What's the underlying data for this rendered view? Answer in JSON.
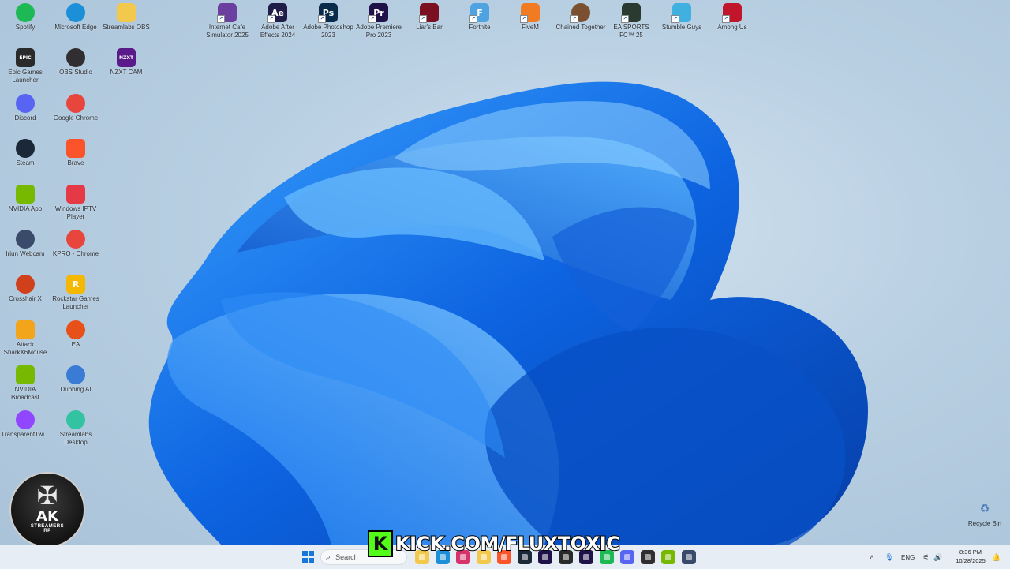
{
  "desktop": {
    "icons": [
      {
        "label": "Spotify",
        "icon": "spotify-icon",
        "color": "#1db954"
      },
      {
        "label": "Microsoft Edge",
        "icon": "edge-icon",
        "color": "#1b8fd8"
      },
      {
        "label": "Streamlabs OBS",
        "icon": "folder-icon",
        "color": "#f2c94c"
      },
      {
        "label": "Internet Cafe Simulator 2025",
        "icon": "game-icon",
        "color": "#6b3fa0"
      },
      {
        "label": "Adobe After Effects 2024",
        "icon": "after-effects-icon",
        "color": "#1f1d48",
        "text": "Ae"
      },
      {
        "label": "Adobe Photoshop 2023",
        "icon": "photoshop-icon",
        "color": "#0a2a4a",
        "text": "Ps"
      },
      {
        "label": "Adobe Premiere Pro 2023",
        "icon": "premiere-icon",
        "color": "#1e1248",
        "text": "Pr"
      },
      {
        "label": "Liar's Bar",
        "icon": "liars-bar-icon",
        "color": "#7a1020"
      },
      {
        "label": "Fortnite",
        "icon": "fortnite-icon",
        "color": "#4fa3e0",
        "text": "F"
      },
      {
        "label": "FiveM",
        "icon": "fivem-icon",
        "color": "#f07b22"
      },
      {
        "label": "Chained Together",
        "icon": "chained-together-icon",
        "color": "#7a5030"
      },
      {
        "label": "EA SPORTS FC™ 25",
        "icon": "ea-fc-icon",
        "color": "#2a3a30"
      },
      {
        "label": "Stumble Guys",
        "icon": "stumble-guys-icon",
        "color": "#3fb0e0"
      },
      {
        "label": "Among Us",
        "icon": "among-us-icon",
        "color": "#c0152a"
      },
      {
        "label": "Epic Games Launcher",
        "icon": "epic-games-icon",
        "color": "#2a2a2a",
        "text": "EPIC"
      },
      {
        "label": "OBS Studio",
        "icon": "obs-icon",
        "color": "#302e31"
      },
      {
        "label": "NZXT CAM",
        "icon": "nzxt-icon",
        "color": "#5a1a8a",
        "text": "NZXT"
      },
      {
        "label": "Discord",
        "icon": "discord-icon",
        "color": "#5865f2"
      },
      {
        "label": "Google Chrome",
        "icon": "chrome-icon",
        "color": "#e8453c"
      },
      {
        "label": "Steam",
        "icon": "steam-icon",
        "color": "#1b2838"
      },
      {
        "label": "Brave",
        "icon": "brave-icon",
        "color": "#fb542b"
      },
      {
        "label": "NVIDIA App",
        "icon": "nvidia-icon",
        "color": "#76b900"
      },
      {
        "label": "Windows IPTV Player",
        "icon": "iptv-player-icon",
        "color": "#e63946"
      },
      {
        "label": "Iriun Webcam",
        "icon": "webcam-icon",
        "color": "#3a4a6a"
      },
      {
        "label": "KPRO - Chrome",
        "icon": "chrome-icon",
        "color": "#e8453c"
      },
      {
        "label": "Crosshair X",
        "icon": "crosshair-icon",
        "color": "#d0401a"
      },
      {
        "label": "Rockstar Games Launcher",
        "icon": "rockstar-icon",
        "color": "#f5b800",
        "text": "R"
      },
      {
        "label": "Attack SharkX6Mouse",
        "icon": "mouse-icon",
        "color": "#f2a51a"
      },
      {
        "label": "EA",
        "icon": "ea-icon",
        "color": "#e8501a"
      },
      {
        "label": "NVIDIA Broadcast",
        "icon": "nvidia-broadcast-icon",
        "color": "#76b900"
      },
      {
        "label": "Dubbing AI",
        "icon": "dubbing-ai-icon",
        "color": "#3a7bd5"
      },
      {
        "label": "TransparentTwi...",
        "icon": "transparent-twitch-icon",
        "color": "#9146ff"
      },
      {
        "label": "Streamlabs Desktop",
        "icon": "streamlabs-icon",
        "color": "#31c3a2"
      }
    ],
    "recycle_bin": {
      "label": "Recycle Bin",
      "icon": "recycle-bin-icon"
    },
    "overlay_logo": {
      "big": "AK",
      "sub": "STREAMERS",
      "sub2": "RP"
    },
    "kick_banner": {
      "k": "K",
      "url": "KICK.COM/FLUXTOXIC"
    }
  },
  "taskbar": {
    "search_placeholder": "Search",
    "pinned": [
      {
        "icon": "file-explorer-icon",
        "color": "#f2c94c"
      },
      {
        "icon": "edge-icon",
        "color": "#1b8fd8"
      },
      {
        "icon": "store-icon",
        "color": "#d6336c"
      },
      {
        "icon": "folder-icon",
        "color": "#f2c94c"
      },
      {
        "icon": "brave-icon",
        "color": "#fb542b"
      },
      {
        "icon": "steam-icon",
        "color": "#1b2838"
      },
      {
        "icon": "adobe-icon",
        "color": "#1e1248"
      },
      {
        "icon": "terminal-icon",
        "color": "#2a2a2a"
      },
      {
        "icon": "premiere-icon",
        "color": "#1e1248"
      },
      {
        "icon": "spotify-icon",
        "color": "#1db954"
      },
      {
        "icon": "discord-icon",
        "color": "#5865f2"
      },
      {
        "icon": "obs-icon",
        "color": "#302e31"
      },
      {
        "icon": "nvidia-icon",
        "color": "#76b900"
      },
      {
        "icon": "webcam-icon",
        "color": "#3a4a6a"
      }
    ],
    "tray": {
      "language": "ENG",
      "time": "8:36 PM",
      "date": "10/28/2025"
    }
  }
}
